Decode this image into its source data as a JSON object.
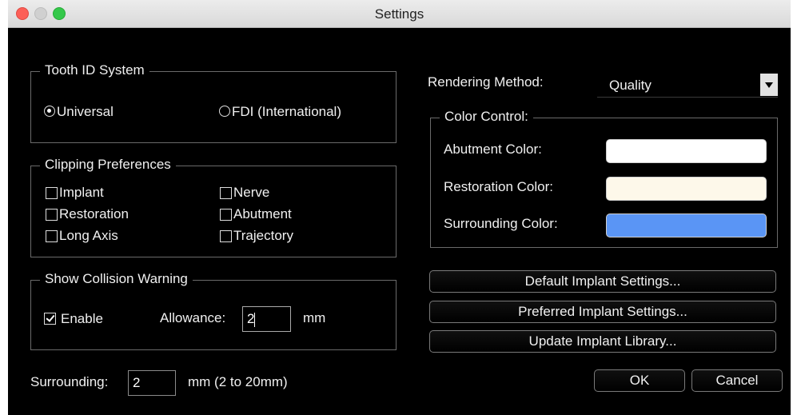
{
  "window": {
    "title": "Settings"
  },
  "tooth_id": {
    "legend": "Tooth ID System",
    "options": [
      {
        "label": "Universal",
        "selected": true
      },
      {
        "label": "FDI (International)",
        "selected": false
      }
    ]
  },
  "clipping": {
    "legend": "Clipping Preferences",
    "items": [
      {
        "label": "Implant",
        "checked": false
      },
      {
        "label": "Nerve",
        "checked": false
      },
      {
        "label": "Restoration",
        "checked": false
      },
      {
        "label": "Abutment",
        "checked": false
      },
      {
        "label": "Long Axis",
        "checked": false
      },
      {
        "label": "Trajectory",
        "checked": false
      }
    ]
  },
  "collision": {
    "legend": "Show Collision Warning",
    "enable_label": "Enable",
    "enable_checked": true,
    "allowance_label": "Allowance:",
    "allowance_value": "2",
    "unit": "mm"
  },
  "surrounding": {
    "label": "Surrounding:",
    "value": "2",
    "hint": "mm (2 to 20mm)"
  },
  "rendering": {
    "label": "Rendering Method:",
    "value": "Quality"
  },
  "color_control": {
    "legend": "Color Control:",
    "abutment": {
      "label": "Abutment Color:",
      "color": "#ffffff"
    },
    "restoration": {
      "label": "Restoration Color:",
      "color": "#fdf8ea"
    },
    "surrounding": {
      "label": "Surrounding Color:",
      "color": "#5a95f5"
    }
  },
  "buttons": {
    "default_implant": "Default Implant Settings...",
    "preferred_implant": "Preferred Implant Settings...",
    "update_library": "Update Implant Library...",
    "ok": "OK",
    "cancel": "Cancel"
  }
}
